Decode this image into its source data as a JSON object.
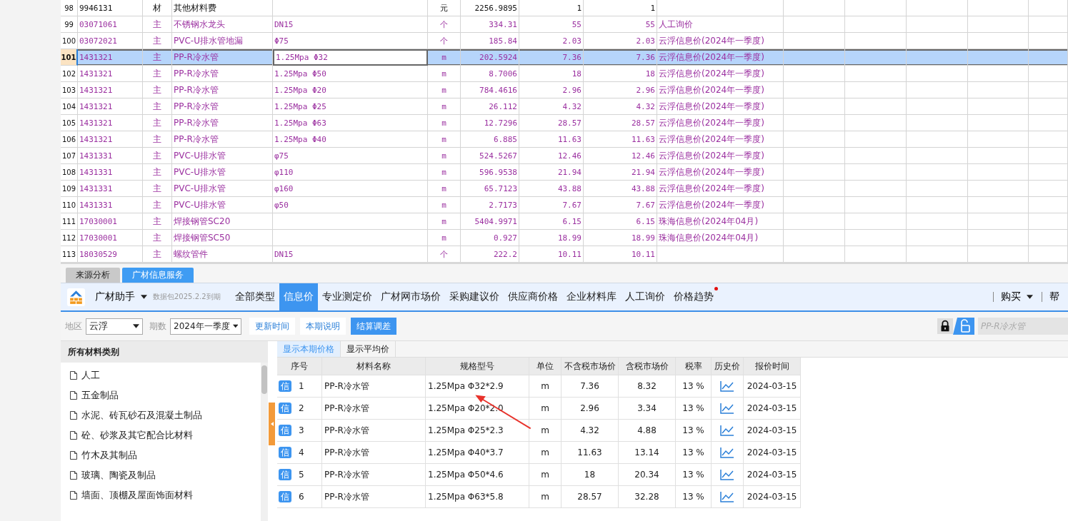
{
  "sheet": {
    "rows": [
      {
        "num": "98",
        "code": "9946131",
        "type": "材",
        "name": "其他材料费",
        "spec": "",
        "unit": "元",
        "price": "2256.9895",
        "qty": "1",
        "market": "1",
        "kind": "plain",
        "selected": false
      },
      {
        "num": "99",
        "code": "03071061",
        "type": "主",
        "name": "不锈钢水龙头",
        "spec": "DN15",
        "unit": "个",
        "price": "334.31",
        "qty": "55",
        "market": "55",
        "source": "人工询价",
        "kind": "main",
        "selected": false
      },
      {
        "num": "100",
        "code": "03072021",
        "type": "主",
        "name": "PVC-U排水管地漏",
        "spec": "Φ75",
        "unit": "个",
        "price": "185.84",
        "qty": "2.03",
        "market": "2.03",
        "source": "云浮信息价(2024年一季度)",
        "kind": "main",
        "selected": false
      },
      {
        "num": "101",
        "code": "1431321",
        "type": "主",
        "name": "PP-R冷水管",
        "spec": "1.25Mpa Φ32",
        "unit": "m",
        "price": "202.5924",
        "qty": "7.36",
        "market": "7.36",
        "source": "云浮信息价(2024年一季度)",
        "kind": "main",
        "selected": true
      },
      {
        "num": "102",
        "code": "1431321",
        "type": "主",
        "name": "PP-R冷水管",
        "spec": "1.25Mpa Φ50",
        "unit": "m",
        "price": "8.7006",
        "qty": "18",
        "market": "18",
        "source": "云浮信息价(2024年一季度)",
        "kind": "main",
        "selected": false
      },
      {
        "num": "103",
        "code": "1431321",
        "type": "主",
        "name": "PP-R冷水管",
        "spec": "1.25Mpa Φ20",
        "unit": "m",
        "price": "784.4616",
        "qty": "2.96",
        "market": "2.96",
        "source": "云浮信息价(2024年一季度)",
        "kind": "main",
        "selected": false
      },
      {
        "num": "104",
        "code": "1431321",
        "type": "主",
        "name": "PP-R冷水管",
        "spec": "1.25Mpa Φ25",
        "unit": "m",
        "price": "26.112",
        "qty": "4.32",
        "market": "4.32",
        "source": "云浮信息价(2024年一季度)",
        "kind": "main",
        "selected": false
      },
      {
        "num": "105",
        "code": "1431321",
        "type": "主",
        "name": "PP-R冷水管",
        "spec": "1.25Mpa Φ63",
        "unit": "m",
        "price": "12.7296",
        "qty": "28.57",
        "market": "28.57",
        "source": "云浮信息价(2024年一季度)",
        "kind": "main",
        "selected": false
      },
      {
        "num": "106",
        "code": "1431321",
        "type": "主",
        "name": "PP-R冷水管",
        "spec": "1.25Mpa Φ40",
        "unit": "m",
        "price": "6.885",
        "qty": "11.63",
        "market": "11.63",
        "source": "云浮信息价(2024年一季度)",
        "kind": "main",
        "selected": false
      },
      {
        "num": "107",
        "code": "1431331",
        "type": "主",
        "name": "PVC-U排水管",
        "spec": "φ75",
        "unit": "m",
        "price": "524.5267",
        "qty": "12.46",
        "market": "12.46",
        "source": "云浮信息价(2024年一季度)",
        "kind": "main",
        "selected": false
      },
      {
        "num": "108",
        "code": "1431331",
        "type": "主",
        "name": "PVC-U排水管",
        "spec": "φ110",
        "unit": "m",
        "price": "596.9538",
        "qty": "21.94",
        "market": "21.94",
        "source": "云浮信息价(2024年一季度)",
        "kind": "main",
        "selected": false
      },
      {
        "num": "109",
        "code": "1431331",
        "type": "主",
        "name": "PVC-U排水管",
        "spec": "φ160",
        "unit": "m",
        "price": "65.7123",
        "qty": "43.88",
        "market": "43.88",
        "source": "云浮信息价(2024年一季度)",
        "kind": "main",
        "selected": false
      },
      {
        "num": "110",
        "code": "1431331",
        "type": "主",
        "name": "PVC-U排水管",
        "spec": "φ50",
        "unit": "m",
        "price": "2.7173",
        "qty": "7.67",
        "market": "7.67",
        "source": "云浮信息价(2024年一季度)",
        "kind": "main",
        "selected": false
      },
      {
        "num": "111",
        "code": "17030001",
        "type": "主",
        "name": "焊接钢管SC20",
        "spec": "",
        "unit": "m",
        "price": "5404.9971",
        "qty": "6.15",
        "market": "6.15",
        "source": "珠海信息价(2024年04月)",
        "kind": "main",
        "selected": false
      },
      {
        "num": "112",
        "code": "17030001",
        "type": "主",
        "name": "焊接钢管SC50",
        "spec": "",
        "unit": "m",
        "price": "0.927",
        "qty": "18.99",
        "market": "18.99",
        "source": "珠海信息价(2024年04月)",
        "kind": "main",
        "selected": false
      },
      {
        "num": "113",
        "code": "18030529",
        "type": "主",
        "name": "螺纹管件",
        "spec": "DN15",
        "unit": "个",
        "price": "222.2",
        "qty": "10.11",
        "market": "10.11",
        "kind": "main",
        "selected": false
      }
    ]
  },
  "panel_tabs": [
    {
      "label": "来源分析",
      "selected": false
    },
    {
      "label": "广材信息服务",
      "selected": true
    }
  ],
  "toolbar": {
    "brand": "广材助手",
    "package": "数据包2025.2.2到期",
    "nav": [
      {
        "label": "全部类型",
        "selected": false,
        "dot": false
      },
      {
        "label": "信息价",
        "selected": true,
        "dot": false
      },
      {
        "label": "专业测定价",
        "selected": false,
        "dot": false
      },
      {
        "label": "广材网市场价",
        "selected": false,
        "dot": false
      },
      {
        "label": "采购建议价",
        "selected": false,
        "dot": false
      },
      {
        "label": "供应商价格",
        "selected": false,
        "dot": false
      },
      {
        "label": "企业材料库",
        "selected": false,
        "dot": false
      },
      {
        "label": "人工询价",
        "selected": false,
        "dot": false
      },
      {
        "label": "价格趋势",
        "selected": false,
        "dot": true
      }
    ],
    "right": [
      "购买",
      "帮"
    ]
  },
  "filters": {
    "region_label": "地区",
    "region": "云浮",
    "period_label": "期数",
    "period": "2024年一季度",
    "buttons": [
      {
        "label": "更新时间",
        "selected": false
      },
      {
        "label": "本期说明",
        "selected": false
      },
      {
        "label": "结算调差",
        "selected": true
      }
    ],
    "search": {
      "placeholder": "PP-R冷水管"
    }
  },
  "tree": {
    "title": "所有材料类别",
    "items": [
      "人工",
      "五金制品",
      "水泥、砖瓦砂石及混凝土制品",
      "砼、砂浆及其它配合比材料",
      "竹木及其制品",
      "玻璃、陶瓷及制品",
      "墙面、顶棚及屋面饰面材料"
    ]
  },
  "price_tabs": [
    {
      "label": "显示本期价格",
      "selected": true
    },
    {
      "label": "显示平均价",
      "selected": false
    }
  ],
  "prices": {
    "columns": [
      "序号",
      "材料名称",
      "规格型号",
      "单位",
      "不含税市场价",
      "含税市场价",
      "税率",
      "历史价",
      "报价时间"
    ],
    "rows": [
      {
        "badge": "信",
        "no": "1",
        "name": "PP-R冷水管",
        "spec": "1.25Mpa Φ32*2.9",
        "unit": "m",
        "price": "7.36",
        "tax_price": "8.32",
        "rate": "13 %",
        "date": "2024-03-15"
      },
      {
        "badge": "信",
        "no": "2",
        "name": "PP-R冷水管",
        "spec": "1.25Mpa Φ20*2.0",
        "unit": "m",
        "price": "2.96",
        "tax_price": "3.34",
        "rate": "13 %",
        "date": "2024-03-15"
      },
      {
        "badge": "信",
        "no": "3",
        "name": "PP-R冷水管",
        "spec": "1.25Mpa Φ25*2.3",
        "unit": "m",
        "price": "4.32",
        "tax_price": "4.88",
        "rate": "13 %",
        "date": "2024-03-15"
      },
      {
        "badge": "信",
        "no": "4",
        "name": "PP-R冷水管",
        "spec": "1.25Mpa Φ40*3.7",
        "unit": "m",
        "price": "11.63",
        "tax_price": "13.14",
        "rate": "13 %",
        "date": "2024-03-15"
      },
      {
        "badge": "信",
        "no": "5",
        "name": "PP-R冷水管",
        "spec": "1.25Mpa Φ50*4.6",
        "unit": "m",
        "price": "18",
        "tax_price": "20.34",
        "rate": "13 %",
        "date": "2024-03-15"
      },
      {
        "badge": "信",
        "no": "6",
        "name": "PP-R冷水管",
        "spec": "1.25Mpa Φ63*5.8",
        "unit": "m",
        "price": "28.57",
        "tax_price": "32.28",
        "rate": "13 %",
        "date": "2024-03-15"
      }
    ]
  }
}
